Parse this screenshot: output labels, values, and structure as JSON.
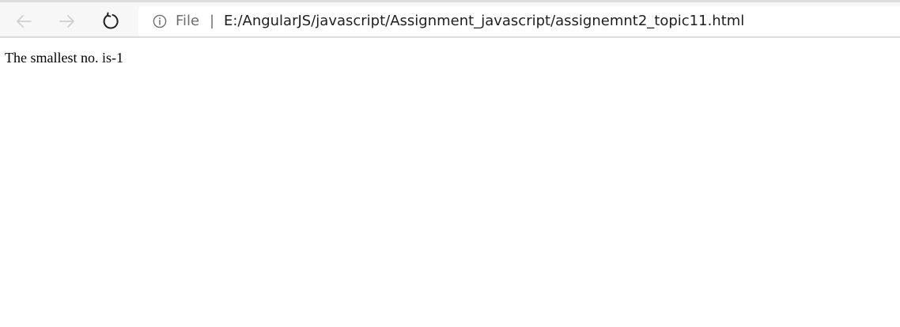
{
  "browser": {
    "nav": {
      "back_icon": "arrow-left-icon",
      "forward_icon": "arrow-right-icon",
      "reload_icon": "reload-icon",
      "back_enabled": false,
      "forward_enabled": false
    },
    "address_bar": {
      "info_icon": "info-icon",
      "scheme_label": "File",
      "separator": "|",
      "url": "E:/AngularJS/javascript/Assignment_javascript/assignemnt2_topic11.html"
    }
  },
  "page": {
    "result_text": "The smallest no. is-1"
  },
  "colors": {
    "toolbar_bg": "#f7f7f7",
    "disabled_icon": "#cfcfcf",
    "active_icon": "#1f1f1f",
    "secondary_text": "#6f6f6f",
    "page_bg": "#ffffff"
  }
}
